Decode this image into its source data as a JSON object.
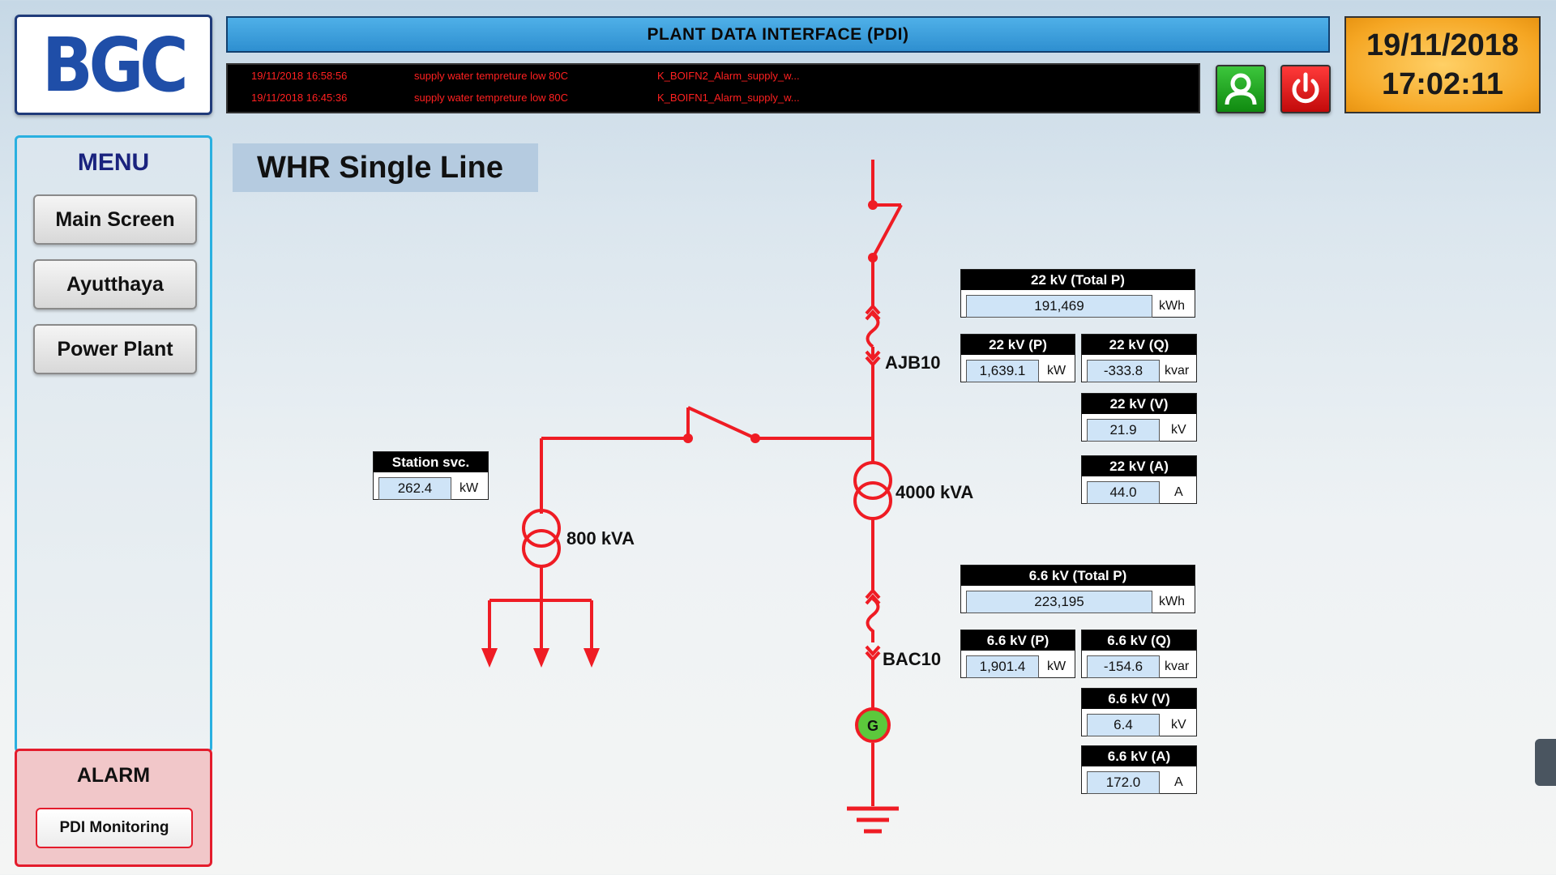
{
  "header": {
    "logo_text": "BGC",
    "title": "PLANT DATA INTERFACE (PDI)",
    "date": "19/11/2018",
    "time": "17:02:11"
  },
  "alarms": [
    {
      "time": "19/11/2018 16:58:56",
      "message": "supply water tempreture low 80C",
      "tag": "K_BOIFN2_Alarm_supply_w..."
    },
    {
      "time": "19/11/2018 16:45:36",
      "message": "supply water tempreture low 80C",
      "tag": "K_BOIFN1_Alarm_supply_w..."
    }
  ],
  "menu": {
    "title": "MENU",
    "items": [
      "Main Screen",
      "Ayutthaya",
      "Power Plant"
    ]
  },
  "alarm_panel": {
    "title": "ALARM",
    "button": "PDI Monitoring"
  },
  "page_title": "WHR Single Line",
  "diagram": {
    "breaker_top": "AJB10",
    "breaker_bottom": "BAC10",
    "transformer_main": "4000 kVA",
    "transformer_station": "800 kVA",
    "generator": "G"
  },
  "measurements": {
    "hv_total_p": {
      "label": "22 kV (Total P)",
      "value": "191,469",
      "unit": "kWh"
    },
    "hv_p": {
      "label": "22 kV (P)",
      "value": "1,639.1",
      "unit": "kW"
    },
    "hv_q": {
      "label": "22 kV (Q)",
      "value": "-333.8",
      "unit": "kvar"
    },
    "hv_v": {
      "label": "22 kV (V)",
      "value": "21.9",
      "unit": "kV"
    },
    "hv_a": {
      "label": "22 kV (A)",
      "value": "44.0",
      "unit": "A"
    },
    "station": {
      "label": "Station svc.",
      "value": "262.4",
      "unit": "kW"
    },
    "mv_total_p": {
      "label": "6.6 kV (Total P)",
      "value": "223,195",
      "unit": "kWh"
    },
    "mv_p": {
      "label": "6.6 kV (P)",
      "value": "1,901.4",
      "unit": "kW"
    },
    "mv_q": {
      "label": "6.6 kV (Q)",
      "value": "-154.6",
      "unit": "kvar"
    },
    "mv_v": {
      "label": "6.6 kV (V)",
      "value": "6.4",
      "unit": "kV"
    },
    "mv_a": {
      "label": "6.6 kV (A)",
      "value": "172.0",
      "unit": "A"
    }
  },
  "colors": {
    "line": "#ef1c24",
    "generator": "#5cc83c",
    "title_bar": "#3aa0e0",
    "datetime_bg": "#f5a623"
  },
  "icons": [
    "user-icon",
    "power-icon"
  ]
}
